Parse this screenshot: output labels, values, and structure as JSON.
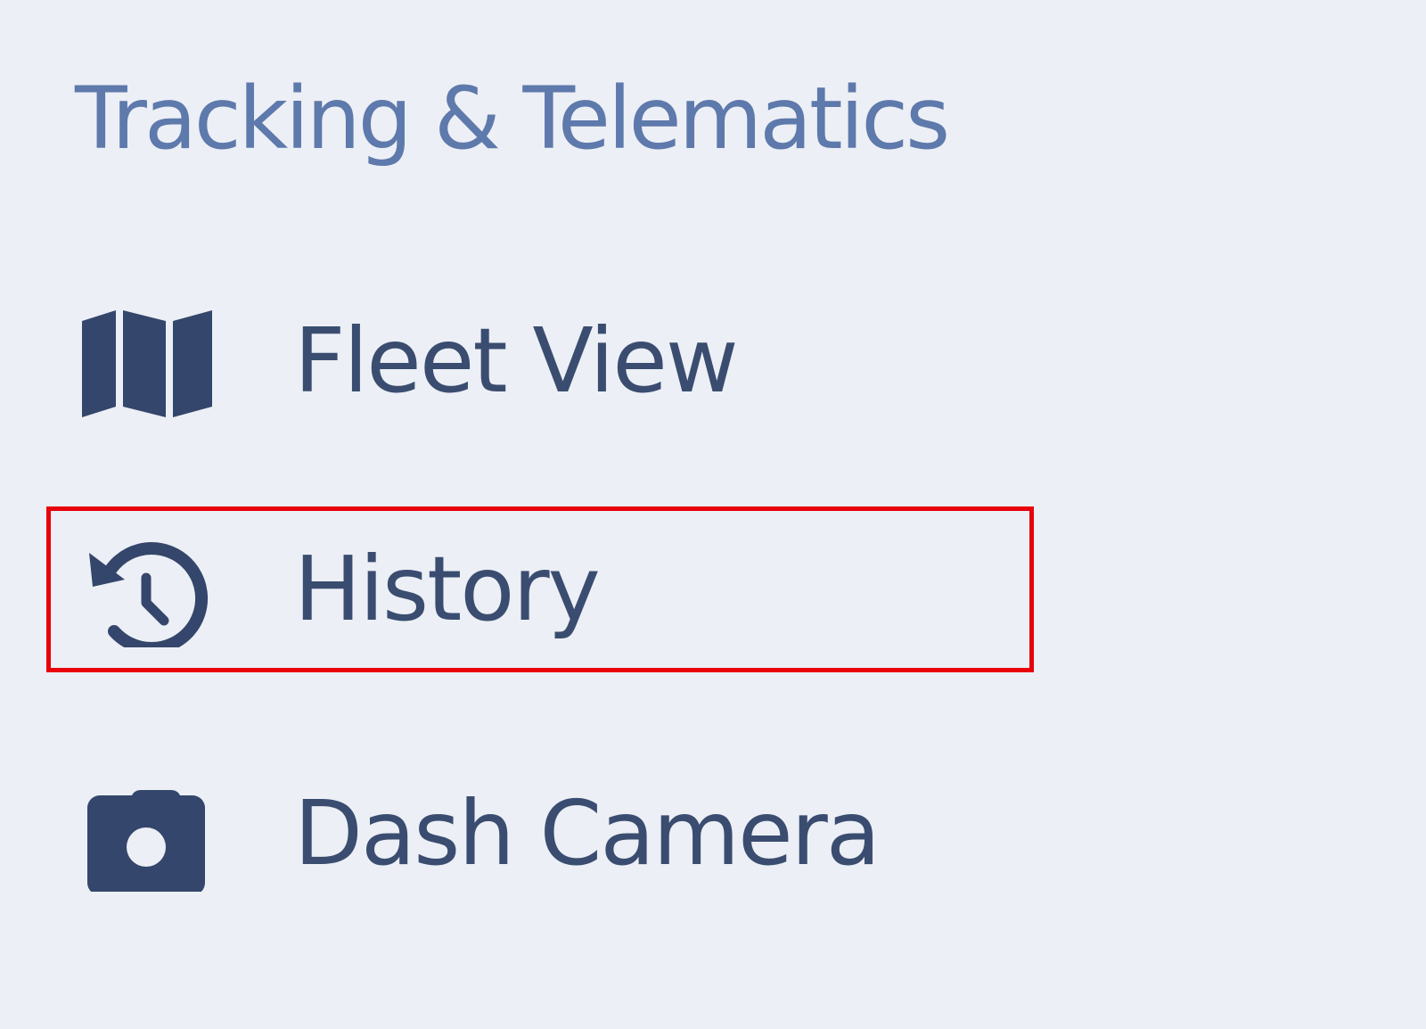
{
  "sidebar": {
    "section_title": "Tracking & Telematics",
    "items": [
      {
        "label": "Fleet View",
        "icon": "map-icon"
      },
      {
        "label": "History",
        "icon": "history-icon",
        "highlighted": true
      },
      {
        "label": "Dash Camera",
        "icon": "camera-icon"
      }
    ]
  },
  "colors": {
    "background": "#eceff5",
    "section_title": "#5e79ab",
    "item_text": "#3a4d70",
    "icon": "#34466b",
    "highlight_border": "#e8000b"
  }
}
